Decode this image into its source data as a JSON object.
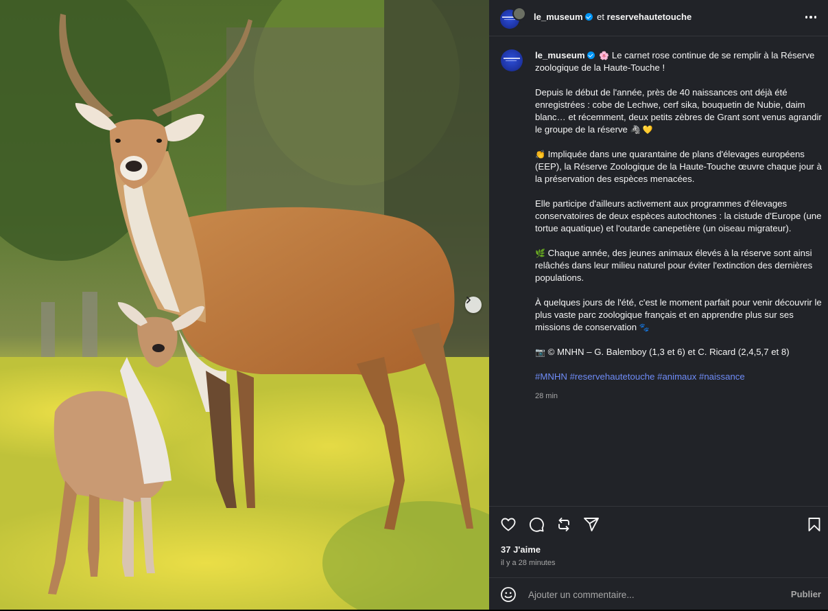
{
  "post": {
    "author": "le_museum",
    "collab_joiner": "et",
    "collaborator": "reservehautetouche",
    "image_alt_animals": "Cobe de Lechwe adulte et son petit dans une prairie fleurie"
  },
  "caption": {
    "username": "le_museum",
    "line1_emoji": "🌸",
    "line1": "Le carnet rose continue de se remplir à la Réserve zoologique de la Haute-Touche !",
    "para2": "Depuis le début de l'année, près de 40 naissances ont déjà été enregistrées : cobe de Lechwe, cerf sika, bouquetin de Nubie, daim blanc… et récemment, deux petits zèbres de Grant sont venus agrandir le groupe de la réserve",
    "para2_emoji": "🦓 💛",
    "para3_emoji": "👏",
    "para3": "Impliquée dans une quarantaine de plans d'élevages européens (EEP), la Réserve Zoologique de la Haute-Touche œuvre chaque jour à la préservation des espèces menacées.",
    "para4": "Elle participe d'ailleurs activement aux programmes d'élevages conservatoires de deux espèces autochtones : la cistude d'Europe (une tortue aquatique) et l'outarde canepetière (un oiseau migrateur).",
    "para5_emoji": "🌿",
    "para5": "Chaque année, des jeunes animaux élevés à la réserve sont ainsi relâchés dans leur milieu naturel pour éviter l'extinction des dernières populations.",
    "para6": "À quelques jours de l'été, c'est le moment parfait pour venir découvrir le plus vaste parc zoologique français et en apprendre plus sur ses missions de conservation",
    "para6_emoji": "🐾",
    "credit_emoji": "📷",
    "credit": "© MNHN – G. Balemboy (1,3 et 6) et C. Ricard (2,4,5,7 et 8)",
    "hashtags": [
      "#MNHN",
      "#reservehautetouche",
      "#animaux",
      "#naissance"
    ],
    "time": "28 min"
  },
  "actions": {
    "likes": "37 J'aime",
    "posted_ago": "il y a 28 minutes"
  },
  "comment": {
    "placeholder": "Ajouter un commentaire...",
    "publish_label": "Publier"
  },
  "icons": {
    "like": "heart-icon",
    "comment": "comment-icon",
    "repost": "repost-icon",
    "share": "share-icon",
    "save": "bookmark-icon",
    "emoji": "emoji-icon",
    "more": "more-icon",
    "next": "chevron-right-icon",
    "verified": "verified-badge-icon"
  },
  "colors": {
    "panel_bg": "#212328",
    "hashtag": "#6f8cf7",
    "verified": "#0095f6",
    "muted_text": "#a8a8a8"
  }
}
